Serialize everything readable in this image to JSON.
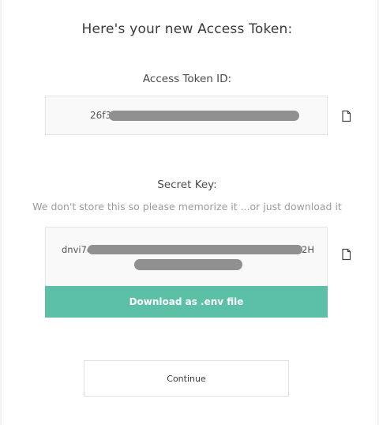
{
  "header": {
    "title": "Here's your new Access Token:"
  },
  "access_token": {
    "label": "Access Token ID:",
    "visible_prefix": "26f3",
    "copy_icon": "copy-document-icon"
  },
  "secret_key": {
    "label": "Secret Key:",
    "hint": "We don't store this so please memorize it ...or just download it",
    "visible_prefix": "dnvi7e",
    "visible_suffix": "2H",
    "copy_icon": "copy-document-icon"
  },
  "actions": {
    "download_label": "Download as .env file",
    "continue_label": "Continue"
  },
  "colors": {
    "accent": "#5bc0a6",
    "redaction": "#909090"
  }
}
